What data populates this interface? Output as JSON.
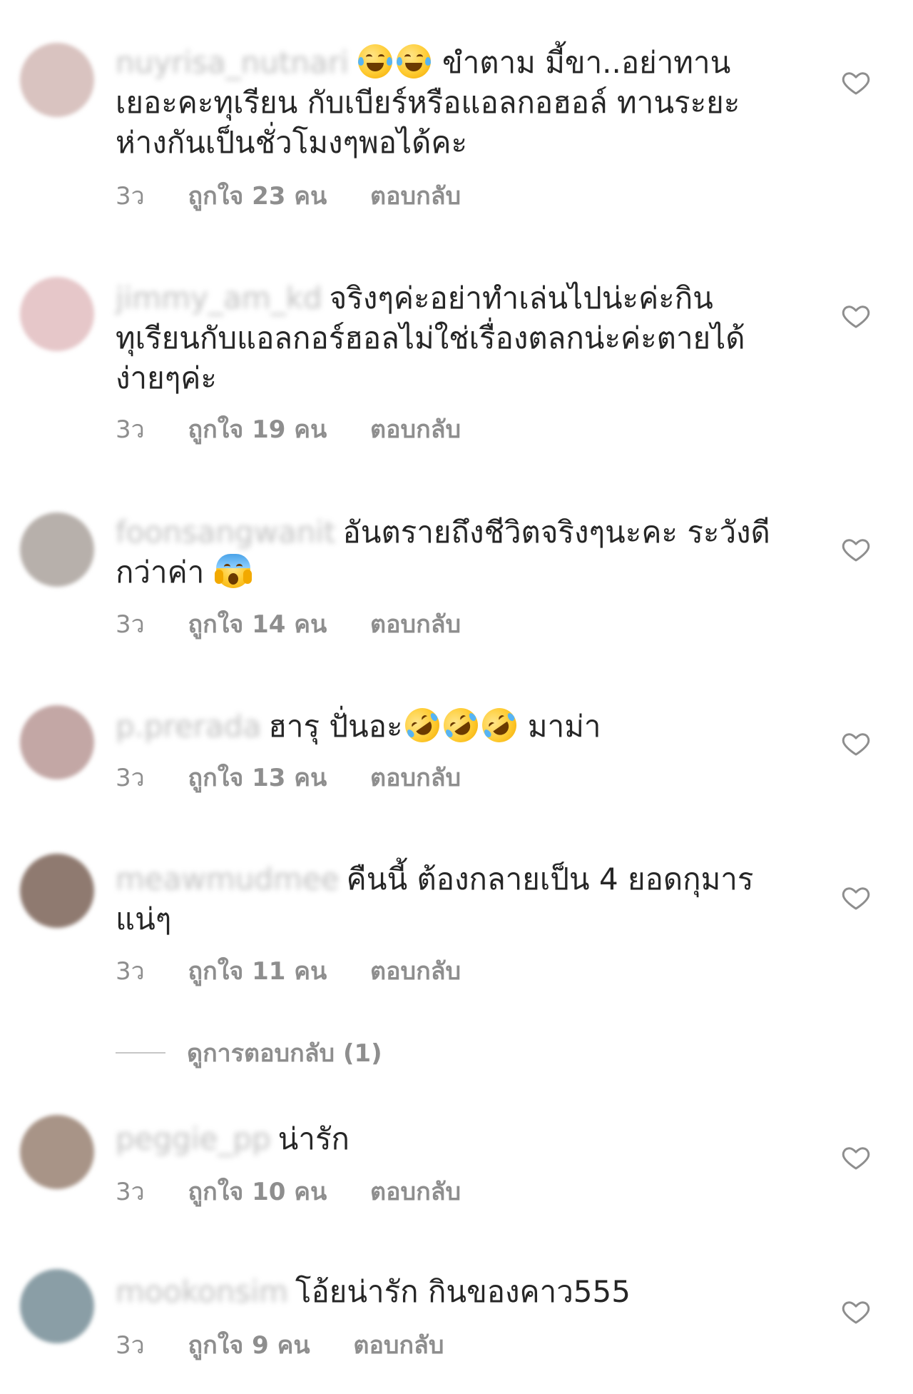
{
  "comments": [
    {
      "username": "nuyrisa_nutnari",
      "avatar_color": "#d9c3c0",
      "text_before": "",
      "emojis": [
        "face-with-tears-of-joy",
        "face-with-tears-of-joy"
      ],
      "text": "ขำตาม มี้ขา..อย่าทานเยอะคะทุเรียน กับเบียร์หรือแอลกอฮอล์ ทานระยะห่างกันเป็นชั่วโมงๆพอได้คะ",
      "time": "3ว",
      "likes": "ถูกใจ 23 คน",
      "reply": "ตอบกลับ"
    },
    {
      "username": "jimmy_am_kd",
      "avatar_color": "#e6c7c9",
      "text": "จริงๆค่ะอย่าทำเล่นไปน่ะค่ะกินทุเรียนกับแอลกอร์ฮอลไม่ใช่เรื่องตลกน่ะค่ะตายได้ง่ายๆค่ะ",
      "time": "3ว",
      "likes": "ถูกใจ 19 คน",
      "reply": "ตอบกลับ"
    },
    {
      "username": "foonsangwanit",
      "avatar_color": "#b7b0ab",
      "text": "อันตรายถึงชีวิตจริงๆนะคะ ระวังดีกว่าค่า",
      "emoji_after": "face-screaming-in-fear",
      "time": "3ว",
      "likes": "ถูกใจ 14 คน",
      "reply": "ตอบกลับ"
    },
    {
      "username": "p.prerada",
      "avatar_color": "#c3a7a5",
      "text": "ฮารุ ปั่นอะ",
      "emojis_after": [
        "rolling-on-the-floor-laughing",
        "rolling-on-the-floor-laughing",
        "rolling-on-the-floor-laughing"
      ],
      "text_after": "มาม่า",
      "time": "3ว",
      "likes": "ถูกใจ 13 คน",
      "reply": "ตอบกลับ"
    },
    {
      "username": "meawmudmee",
      "avatar_color": "#8f7a70",
      "text": "คืนนี้ ต้องกลายเป็น 4 ยอดกุมารแน่ๆ",
      "time": "3ว",
      "likes": "ถูกใจ 11 คน",
      "reply": "ตอบกลับ"
    },
    {
      "username": "peggie_pp",
      "avatar_color": "#a89487",
      "text": "น่ารัก",
      "time": "3ว",
      "likes": "ถูกใจ 10 คน",
      "reply": "ตอบกลับ"
    },
    {
      "username": "mookonsim",
      "avatar_color": "#8a9ea6",
      "text": "โอ้ยน่ารัก กินของคาว555",
      "time": "3ว",
      "likes": "ถูกใจ 9 คน",
      "reply": "ตอบกลับ"
    }
  ],
  "view_replies": "ดูการตอบกลับ (1)",
  "icons": {
    "like": "heart-outline-icon"
  },
  "colors": {
    "text": "#262626",
    "meta": "#8e8e8e"
  }
}
